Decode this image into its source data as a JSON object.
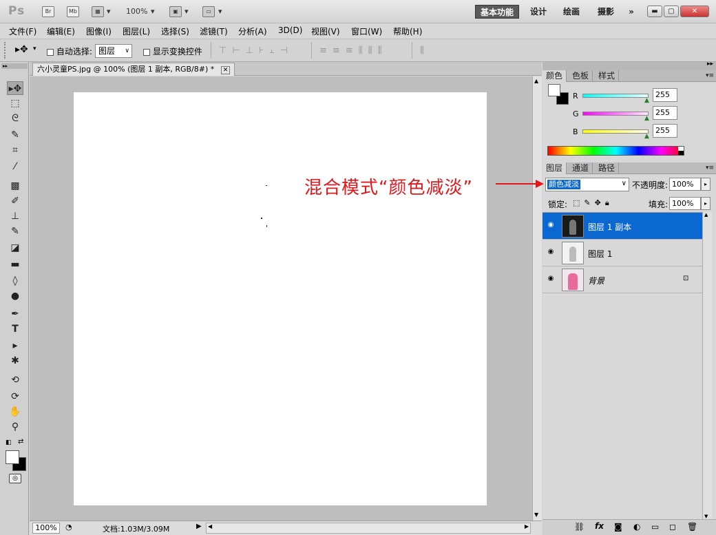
{
  "app": {
    "logo": "Ps",
    "br_label": "Br",
    "mb_label": "Mb",
    "zoom": "100%"
  },
  "workspaces": [
    "基本功能",
    "设计",
    "绘画",
    "摄影"
  ],
  "menu": [
    "文件(F)",
    "编辑(E)",
    "图像(I)",
    "图层(L)",
    "选择(S)",
    "滤镜(T)",
    "分析(A)",
    "3D(D)",
    "视图(V)",
    "窗口(W)",
    "帮助(H)"
  ],
  "options": {
    "auto_select_label": "自动选择:",
    "auto_select_value": "图层",
    "show_transform_label": "显示变换控件"
  },
  "document": {
    "tab_title": "六小灵童PS.jpg @ 100% (图层 1 副本, RGB/8#) *",
    "zoom": "100%",
    "status": "文档:1.03M/3.09M"
  },
  "color_panel": {
    "tabs": [
      "颜色",
      "色板",
      "样式"
    ],
    "channels": [
      {
        "label": "R",
        "value": "255",
        "color": "#00e5e5"
      },
      {
        "label": "G",
        "value": "255",
        "color": "#e500e5"
      },
      {
        "label": "B",
        "value": "255",
        "color": "#e5e500"
      }
    ]
  },
  "layers_panel": {
    "tabs": [
      "图层",
      "通道",
      "路径"
    ],
    "blend_mode": "颜色减淡",
    "opacity_label": "不透明度:",
    "opacity": "100%",
    "lock_label": "锁定:",
    "fill_label": "填充:",
    "fill": "100%",
    "layers": [
      {
        "name": "图层 1 副本",
        "selected": true
      },
      {
        "name": "图层 1",
        "selected": false
      },
      {
        "name": "背景",
        "selected": false
      }
    ]
  },
  "annotation": "混合模式“颜色减淡”"
}
